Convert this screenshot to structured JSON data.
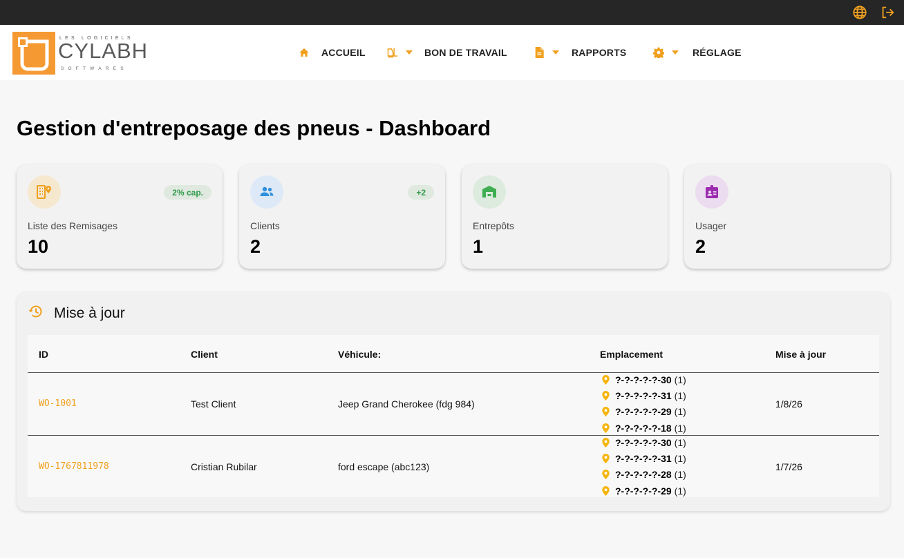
{
  "topbar": {
    "icons": [
      "globe-icon",
      "logout-icon"
    ]
  },
  "logo": {
    "line1": "LES LOGICIELS",
    "brand": "CYLABH",
    "line2": "SOFTWARES"
  },
  "nav": {
    "items": [
      {
        "label": "ACCUEIL",
        "icon": "home-icon"
      },
      {
        "label": "BON DE TRAVAIL",
        "icon": "forklift-icon"
      },
      {
        "label": "RAPPORTS",
        "icon": "document-icon"
      },
      {
        "label": "RÉGLAGE",
        "icon": "gear-icon"
      }
    ]
  },
  "page": {
    "title": "Gestion d'entreposage des pneus - Dashboard"
  },
  "cards": [
    {
      "label": "Liste des Remisages",
      "value": "10",
      "badge": "2% cap.",
      "icon": "storage-location-icon"
    },
    {
      "label": "Clients",
      "value": "2",
      "badge": "+2",
      "icon": "people-icon"
    },
    {
      "label": "Entrepôts",
      "value": "1",
      "icon": "warehouse-icon"
    },
    {
      "label": "Usager",
      "value": "2",
      "icon": "id-badge-icon"
    }
  ],
  "updates": {
    "title": "Mise à jour",
    "icon": "history-icon",
    "columns": [
      "ID",
      "Client",
      "Véhicule:",
      "Emplacement",
      "Mise à jour"
    ],
    "rows": [
      {
        "id": "WO-1001",
        "client": "Test Client",
        "vehicle": "Jeep Grand Cherokee (fdg 984)",
        "locations": [
          {
            "code": "?-?-?-?-?-30",
            "qty": "(1)"
          },
          {
            "code": "?-?-?-?-?-31",
            "qty": "(1)"
          },
          {
            "code": "?-?-?-?-?-29",
            "qty": "(1)"
          },
          {
            "code": "?-?-?-?-?-18",
            "qty": "(1)"
          }
        ],
        "updated": "1/8/26"
      },
      {
        "id": "WO-1767811978",
        "client": "Cristian Rubilar",
        "vehicle": "ford escape (abc123)",
        "locations": [
          {
            "code": "?-?-?-?-?-30",
            "qty": "(1)"
          },
          {
            "code": "?-?-?-?-?-31",
            "qty": "(1)"
          },
          {
            "code": "?-?-?-?-?-28",
            "qty": "(1)"
          },
          {
            "code": "?-?-?-?-?-29",
            "qty": "(1)"
          }
        ],
        "updated": "1/7/26"
      }
    ]
  },
  "colors": {
    "accent": "#f0a01e",
    "topbar": "#262626",
    "badge_text": "#2e9a4a"
  }
}
